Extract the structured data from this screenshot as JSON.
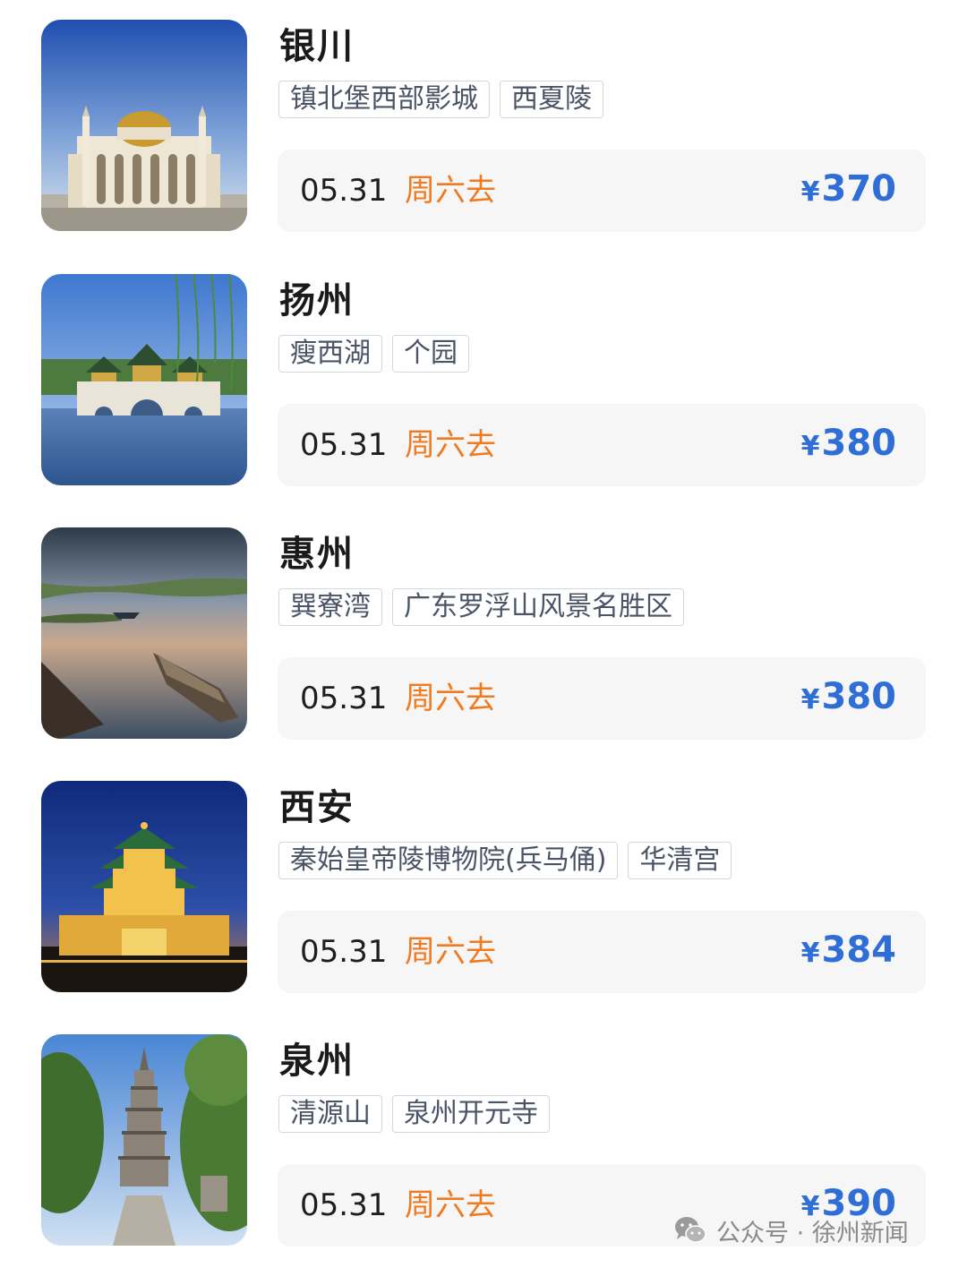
{
  "items": [
    {
      "city": "银川",
      "tags": [
        "镇北堡西部影城",
        "西夏陵"
      ],
      "date": "05.31",
      "day": "周六去",
      "currency": "¥",
      "price": "370",
      "image": "mosque-photo"
    },
    {
      "city": "扬州",
      "tags": [
        "瘦西湖",
        "个园"
      ],
      "date": "05.31",
      "day": "周六去",
      "currency": "¥",
      "price": "380",
      "image": "five-pavilion-bridge-photo"
    },
    {
      "city": "惠州",
      "tags": [
        "巽寮湾",
        "广东罗浮山风景名胜区"
      ],
      "date": "05.31",
      "day": "周六去",
      "currency": "¥",
      "price": "380",
      "image": "boats-on-water-photo"
    },
    {
      "city": "西安",
      "tags": [
        "秦始皇帝陵博物院(兵马俑)",
        "华清宫"
      ],
      "date": "05.31",
      "day": "周六去",
      "currency": "¥",
      "price": "384",
      "image": "bell-tower-night-photo"
    },
    {
      "city": "泉州",
      "tags": [
        "清源山",
        "泉州开元寺"
      ],
      "date": "05.31",
      "day": "周六去",
      "currency": "¥",
      "price": "390",
      "image": "pagoda-photo"
    }
  ],
  "watermark": {
    "icon": "wechat-icon",
    "text": "公众号 · 徐州新闻"
  },
  "colors": {
    "city": "#1a1a1a",
    "day": "#f07a1f",
    "price": "#2f6ed6",
    "price_row_bg": "#f6f6f7",
    "tag_border": "#d4d8de"
  }
}
